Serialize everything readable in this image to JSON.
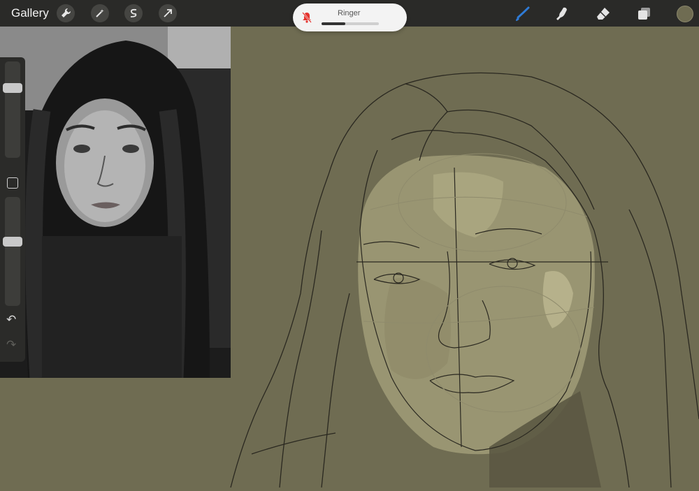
{
  "toolbar": {
    "gallery_label": "Gallery",
    "actions_icon": "wrench-icon",
    "adjustments_icon": "magic-wand-icon",
    "selection_icon": "selection-s-icon",
    "transform_icon": "arrow-cursor-icon",
    "brush_icon": "brush-icon",
    "smudge_icon": "smudge-icon",
    "eraser_icon": "eraser-icon",
    "layers_icon": "layers-icon",
    "active_color": "#6f6c52",
    "brush_color": "#2f7bd6"
  },
  "volume_hud": {
    "label": "Ringer",
    "level": 0.42,
    "muted_icon": "bell-slash-icon",
    "muted_color": "#e5322d"
  },
  "sidebar": {
    "brush_size_level": 0.75,
    "opacity_level": 0.6,
    "modify_icon": "square-icon",
    "undo_icon": "undo-arrow-icon",
    "redo_icon": "redo-arrow-icon"
  },
  "canvas": {
    "background_color": "#6f6c52"
  }
}
